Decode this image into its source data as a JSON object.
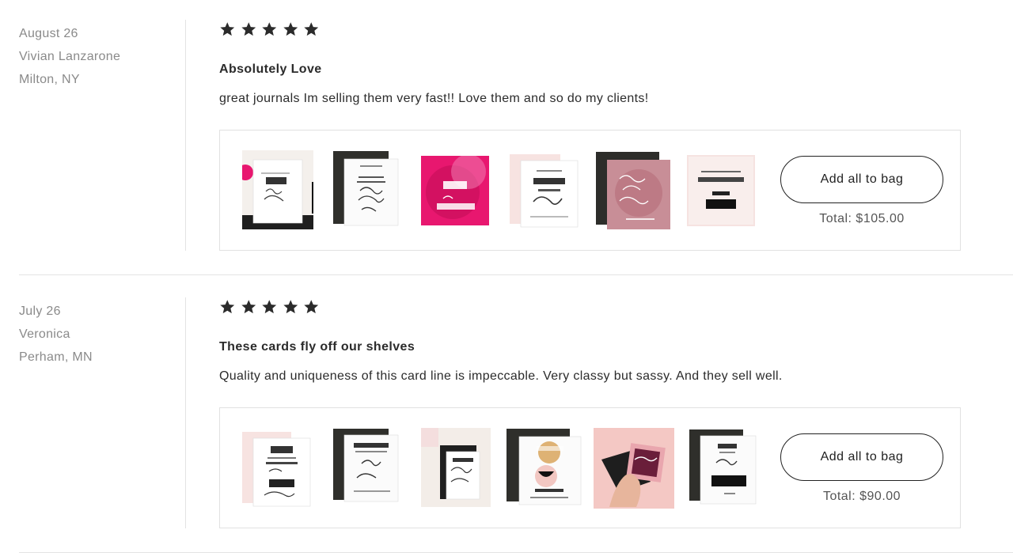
{
  "reviews": [
    {
      "date": "August 26",
      "name": "Vivian Lanzarone",
      "location": "Milton, NY",
      "rating": 5,
      "title": "Absolutely Love",
      "body": "great journals Im selling them very fast!! Love them and so do my clients!",
      "bundle": {
        "add_label": "Add all to bag",
        "total": "Total: $105.00"
      }
    },
    {
      "date": "July 26",
      "name": "Veronica",
      "location": "Perham, MN",
      "rating": 5,
      "title": "These cards fly off our shelves",
      "body": "Quality and uniqueness of this card line is impeccable. Very classy but sassy. And they sell well.",
      "bundle": {
        "add_label": "Add all to bag",
        "total": "Total: $90.00"
      }
    }
  ],
  "colors": {
    "star": "#2b2b2b",
    "muted_text": "#8a8a8a",
    "border": "#e1e1e1",
    "pink_accent": "#e8176f"
  }
}
